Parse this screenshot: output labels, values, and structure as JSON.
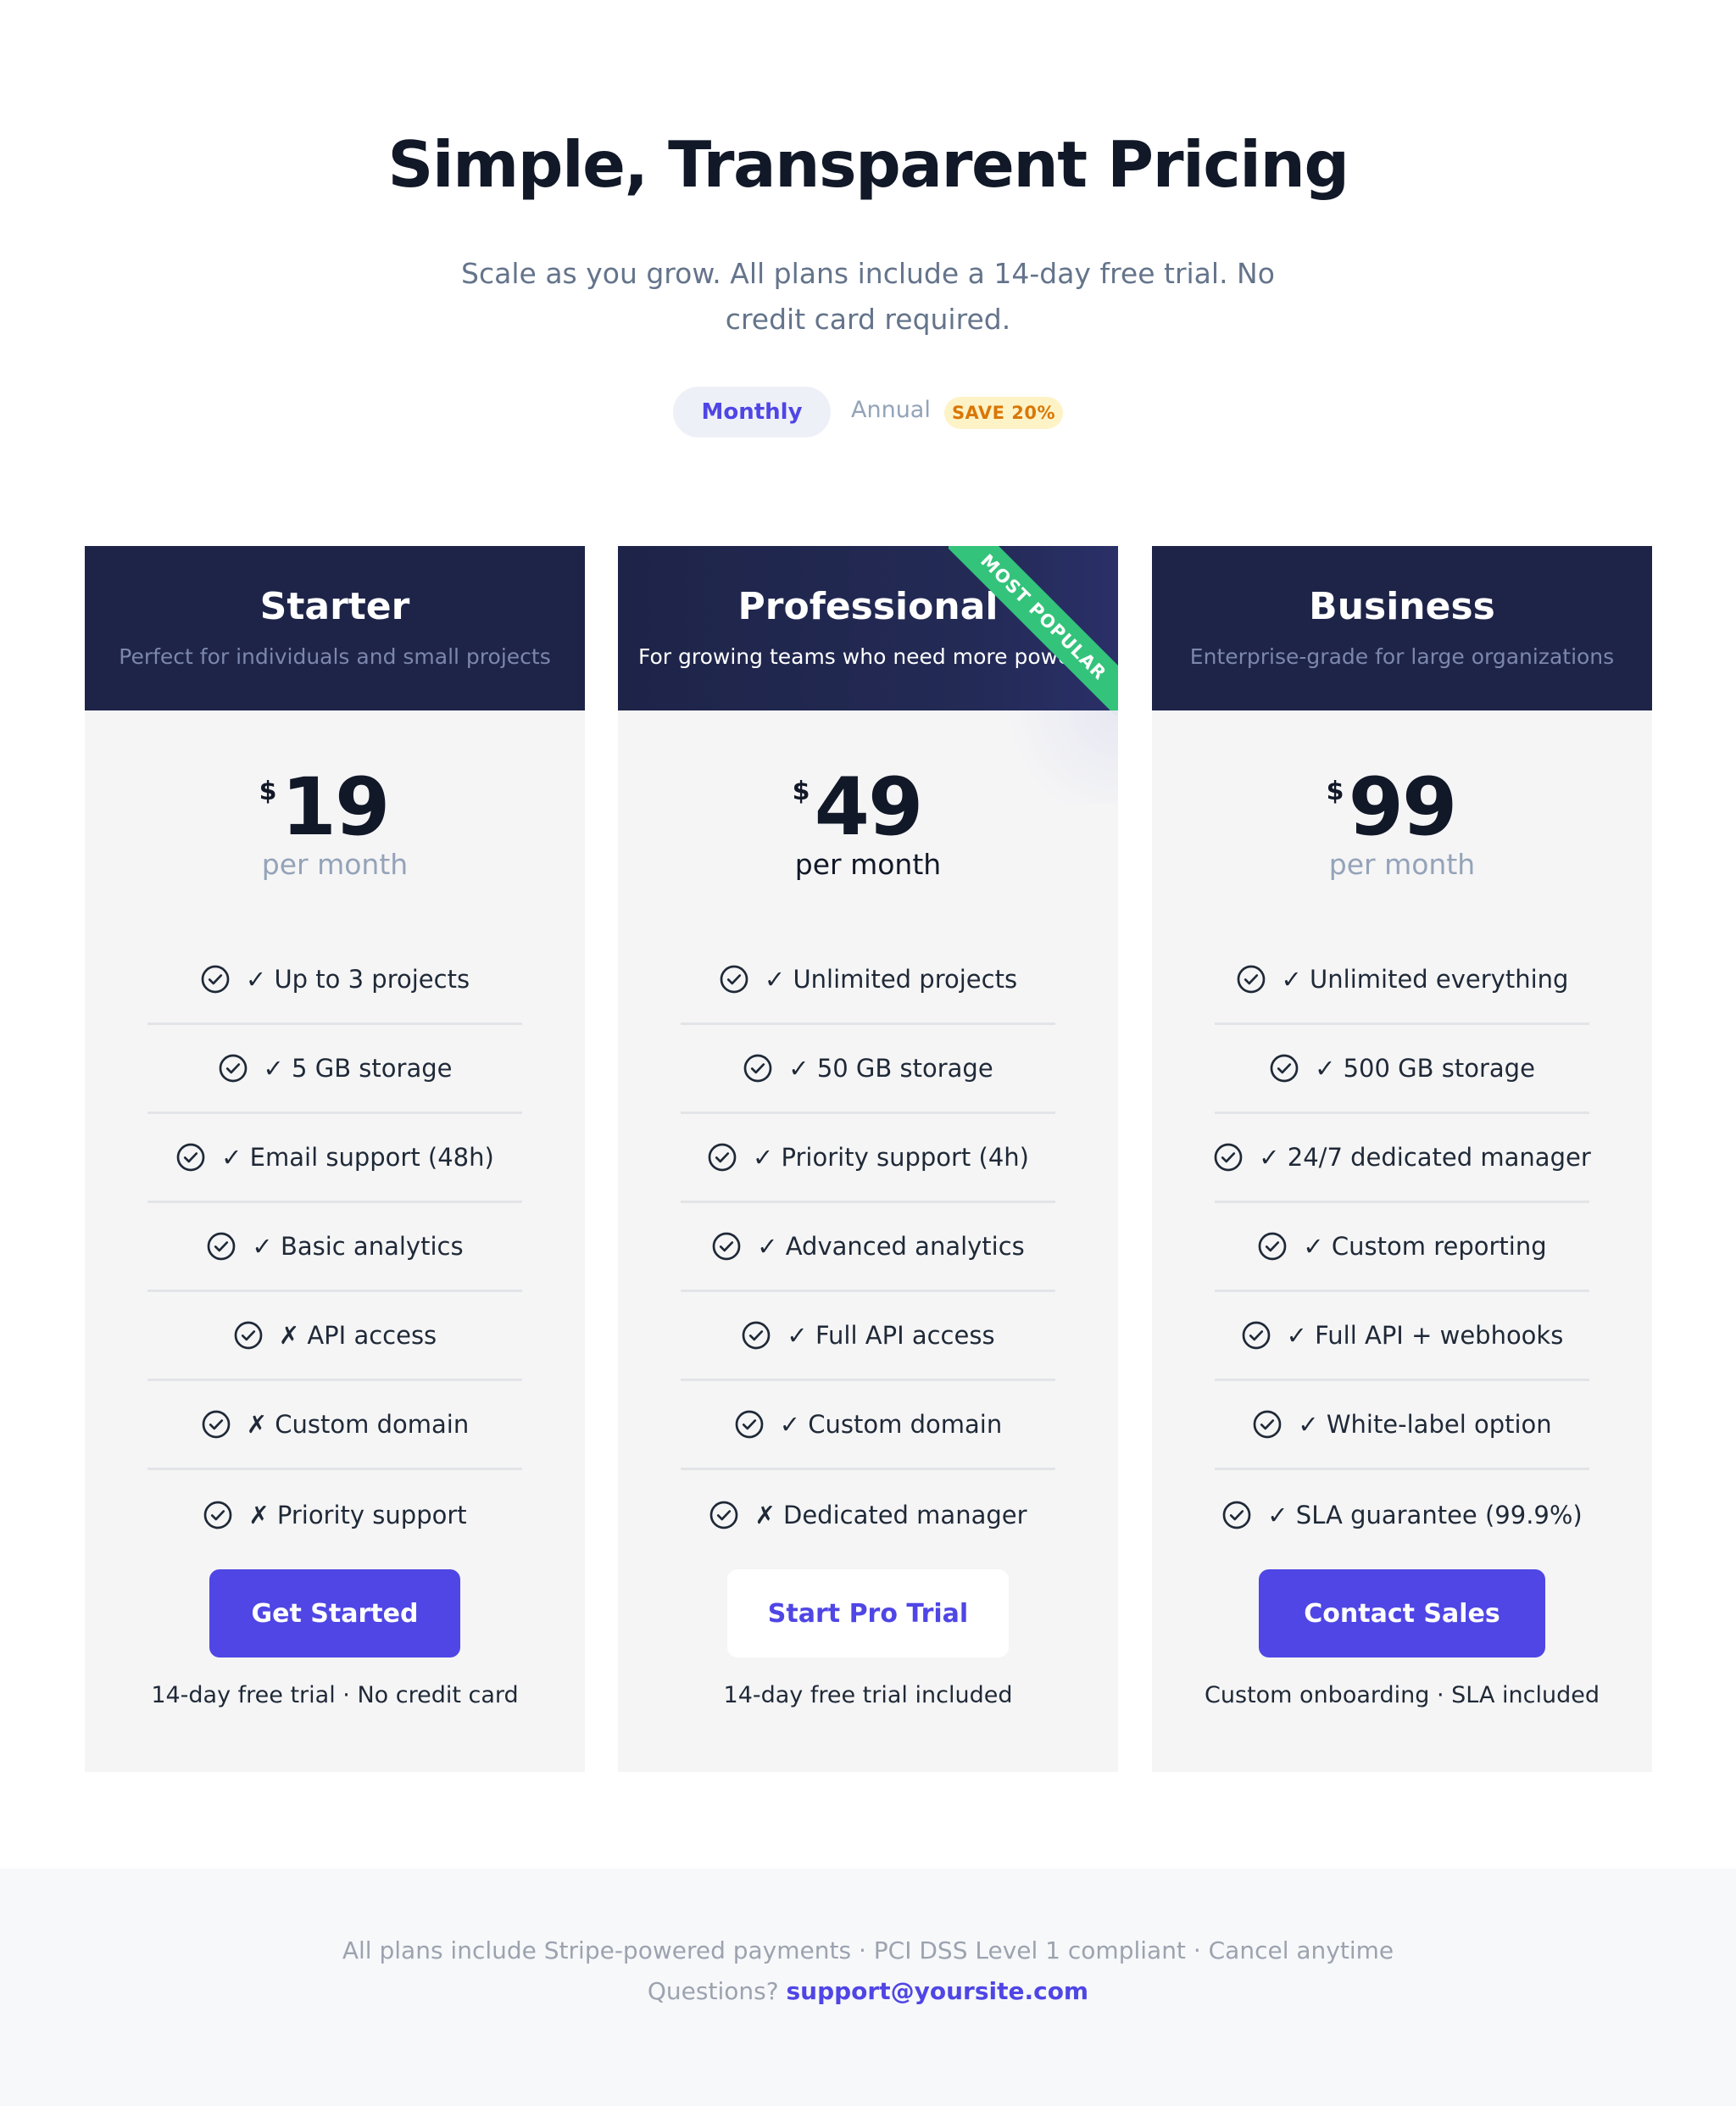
{
  "header": {
    "title": "Simple, Transparent Pricing",
    "subtitle": "Scale as you grow. All plans include a 14-day free trial. No credit card required."
  },
  "billing_toggle": {
    "monthly_label": "Monthly",
    "annual_label": "Annual",
    "save_badge": "SAVE 20%",
    "selected": "Monthly"
  },
  "plans": [
    {
      "name": "Starter",
      "description": "Perfect for individuals and small projects",
      "currency": "$",
      "price": "19",
      "period": "per month",
      "features": [
        "✓ Up to 3 projects",
        "✓ 5 GB storage",
        "✓ Email support (48h)",
        "✓ Basic analytics",
        "✗ API access",
        "✗ Custom domain",
        "✗ Priority support"
      ],
      "cta_label": "Get Started",
      "cta_note": "14-day free trial · No credit card"
    },
    {
      "name": "Professional",
      "description": "For growing teams who need more power",
      "ribbon": "MOST POPULAR",
      "currency": "$",
      "price": "49",
      "period": "per month",
      "features": [
        "✓ Unlimited projects",
        "✓ 50 GB storage",
        "✓ Priority support (4h)",
        "✓ Advanced analytics",
        "✓ Full API access",
        "✓ Custom domain",
        "✗ Dedicated manager"
      ],
      "cta_label": "Start Pro Trial",
      "cta_note": "14-day free trial included"
    },
    {
      "name": "Business",
      "description": "Enterprise-grade for large organizations",
      "currency": "$",
      "price": "99",
      "period": "per month",
      "features": [
        "✓ Unlimited everything",
        "✓ 500 GB storage",
        "✓ 24/7 dedicated manager",
        "✓ Custom reporting",
        "✓ Full API + webhooks",
        "✓ White-label option",
        "✓ SLA guarantee (99.9%)"
      ],
      "cta_label": "Contact Sales",
      "cta_note": "Custom onboarding · SLA included"
    }
  ],
  "footer": {
    "line1": "All plans include Stripe-powered payments · PCI DSS Level 1 compliant · Cancel anytime",
    "questions_label": "Questions?",
    "email": "support@yoursite.com"
  },
  "colors": {
    "accent": "#4f46e5",
    "card_header": "#1e2448",
    "ribbon": "#34c37b",
    "badge_bg": "#fef3c7",
    "badge_text": "#d97706"
  },
  "icons": {
    "feature": "check-circle-icon"
  }
}
